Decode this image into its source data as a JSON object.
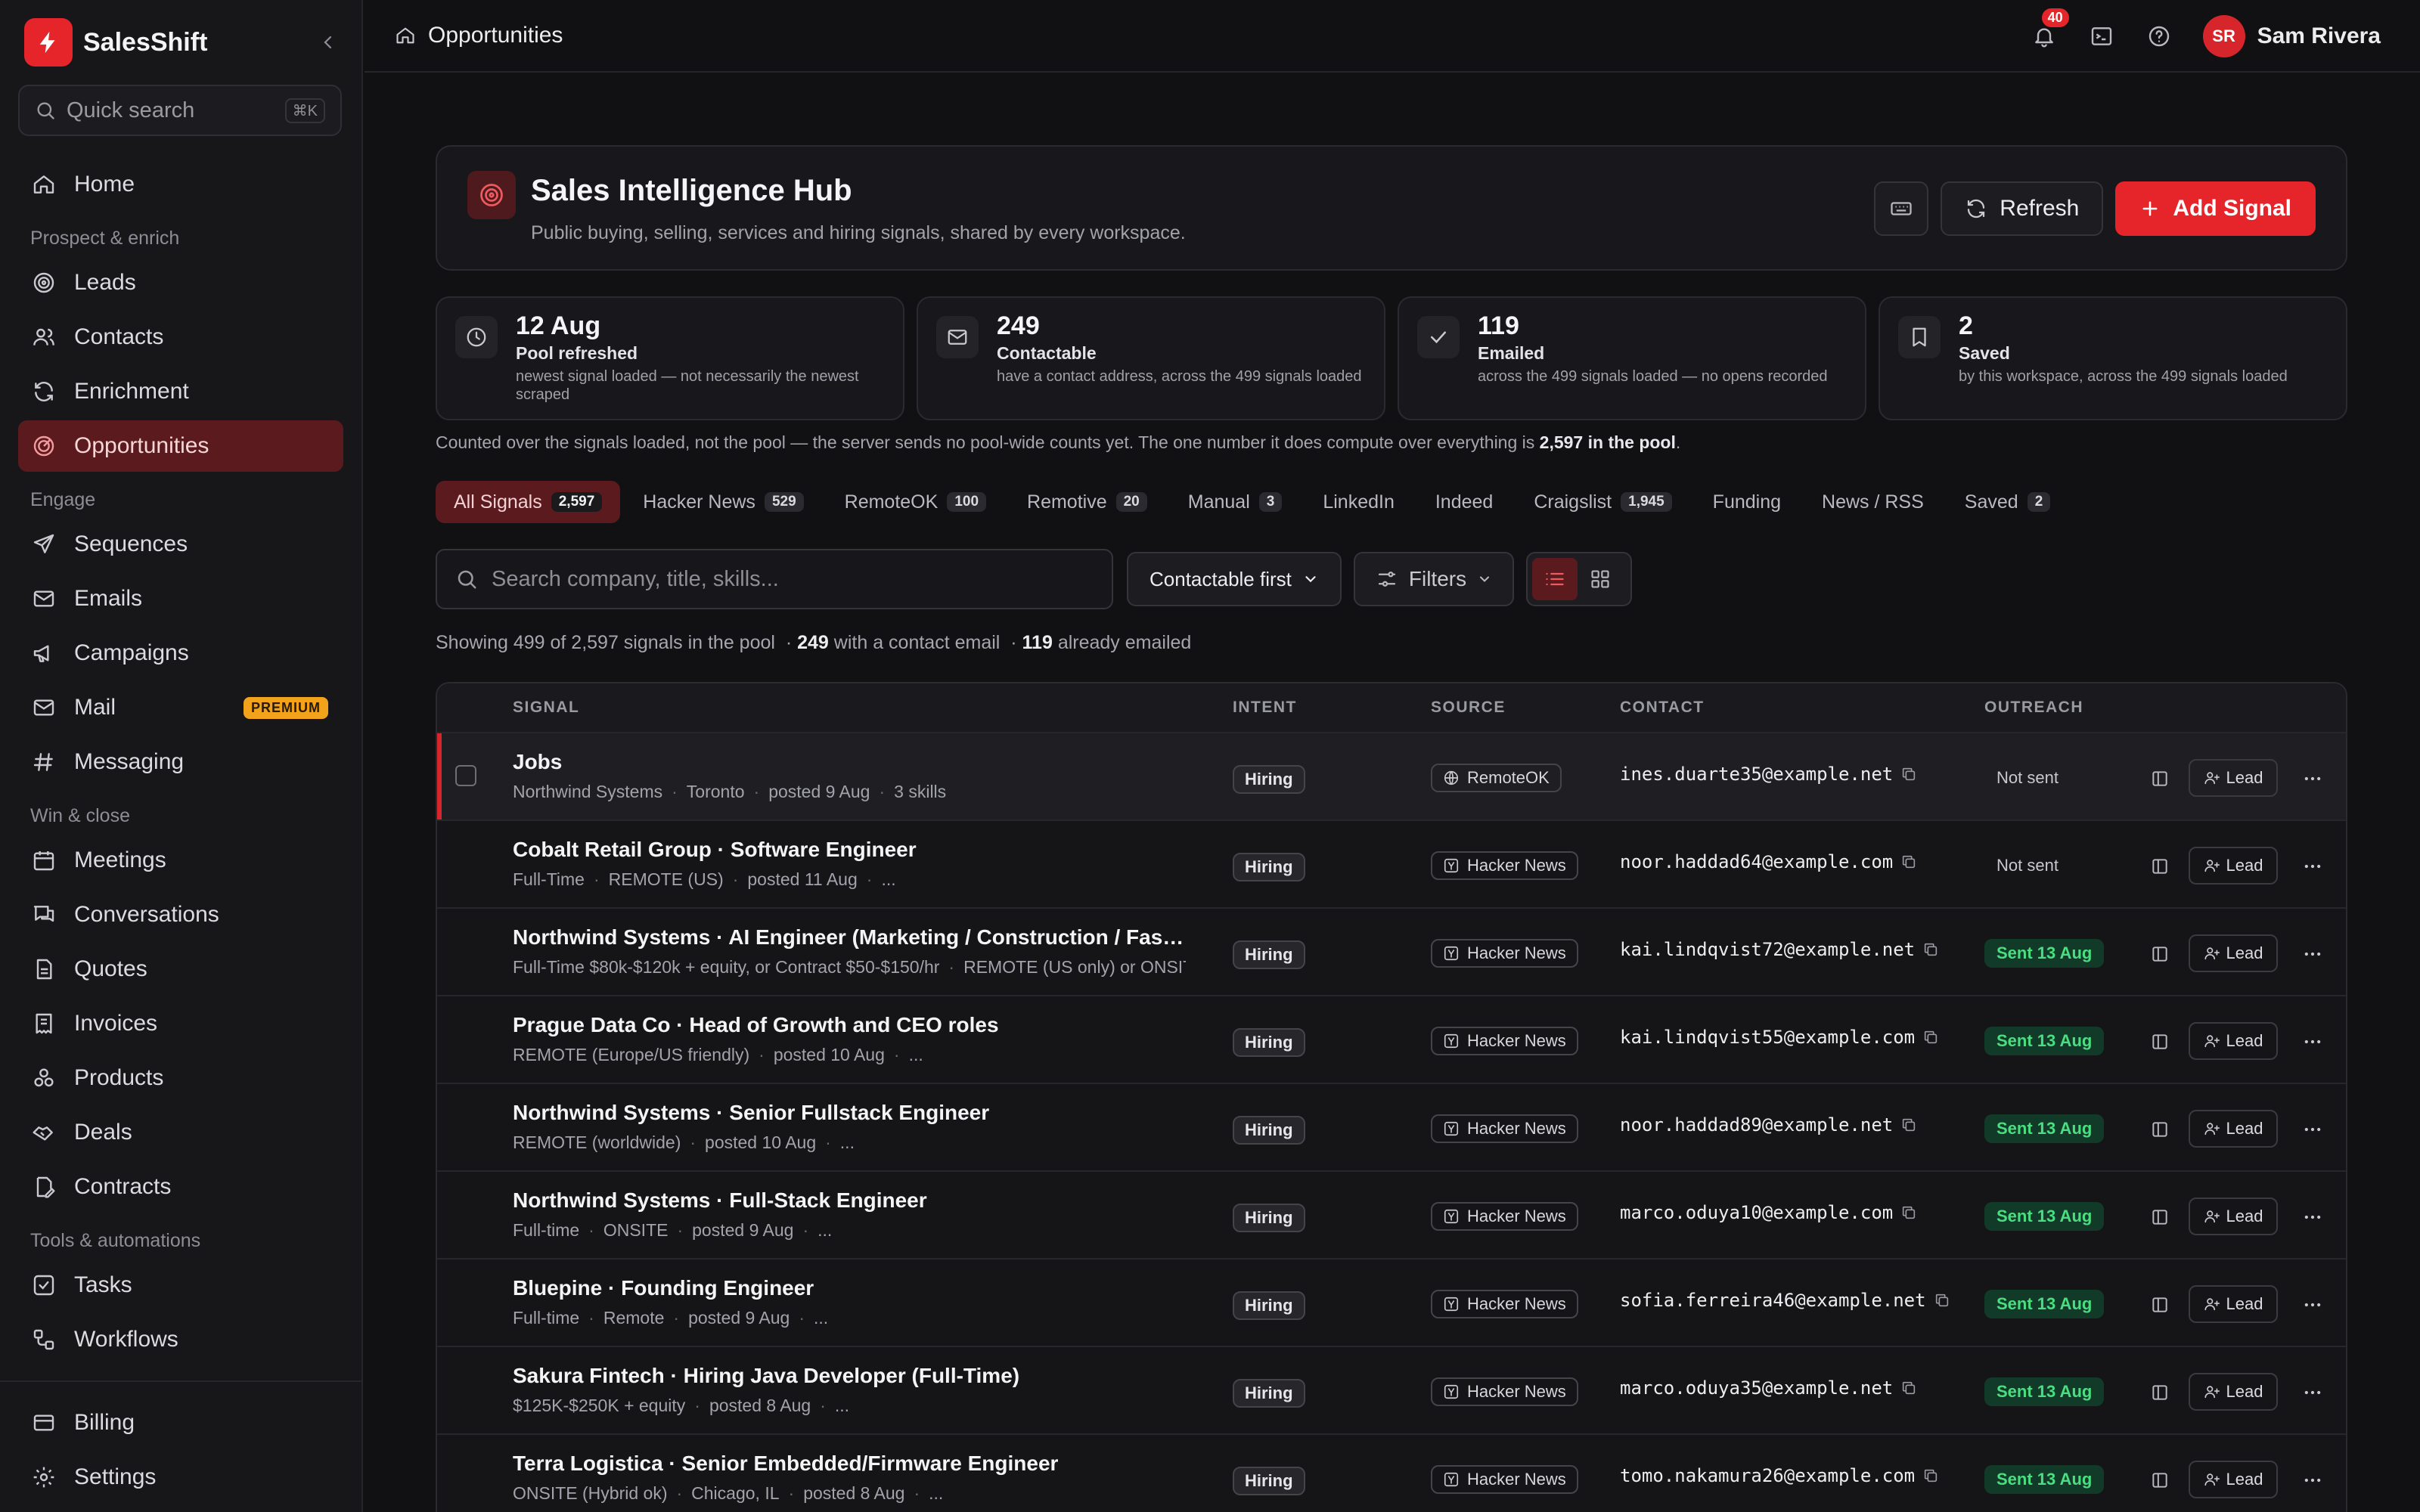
{
  "brand": {
    "name": "SalesShift"
  },
  "colors": {
    "accent": "#E5252A",
    "active_bg": "#5B1A1E",
    "sent_green": "#4ADE80",
    "premium": "#F2A21B"
  },
  "sidebar": {
    "quick_search": {
      "label": "Quick search",
      "shortcut": "⌘K"
    },
    "home": {
      "label": "Home",
      "icon": "home-icon"
    },
    "sections": [
      {
        "title": "Prospect & enrich",
        "items": [
          {
            "label": "Leads",
            "icon": "target-icon"
          },
          {
            "label": "Contacts",
            "icon": "users-icon"
          },
          {
            "label": "Enrichment",
            "icon": "refresh-icon"
          },
          {
            "label": "Opportunities",
            "icon": "radar-icon",
            "active": true
          }
        ]
      },
      {
        "title": "Engage",
        "items": [
          {
            "label": "Sequences",
            "icon": "send-icon"
          },
          {
            "label": "Emails",
            "icon": "mail-icon"
          },
          {
            "label": "Campaigns",
            "icon": "megaphone-icon"
          },
          {
            "label": "Mail",
            "icon": "inbox-icon",
            "badge": "PREMIUM"
          },
          {
            "label": "Messaging",
            "icon": "hash-icon"
          }
        ]
      },
      {
        "title": "Win & close",
        "items": [
          {
            "label": "Meetings",
            "icon": "calendar-icon"
          },
          {
            "label": "Conversations",
            "icon": "chat-icon"
          },
          {
            "label": "Quotes",
            "icon": "document-icon"
          },
          {
            "label": "Invoices",
            "icon": "receipt-icon"
          },
          {
            "label": "Products",
            "icon": "boxes-icon"
          },
          {
            "label": "Deals",
            "icon": "handshake-icon"
          },
          {
            "label": "Contracts",
            "icon": "contract-icon"
          }
        ]
      },
      {
        "title": "Tools & automations",
        "items": [
          {
            "label": "Tasks",
            "icon": "checkbox-icon"
          },
          {
            "label": "Workflows",
            "icon": "workflow-icon"
          }
        ]
      }
    ],
    "footer": [
      {
        "label": "Billing",
        "icon": "card-icon"
      },
      {
        "label": "Settings",
        "icon": "gear-icon"
      }
    ]
  },
  "topbar": {
    "breadcrumb": "Opportunities",
    "notification_count": "40",
    "user": {
      "initials": "SR",
      "name": "Sam Rivera"
    }
  },
  "hub": {
    "title": "Sales Intelligence Hub",
    "subtitle": "Public buying, selling, services and hiring signals, shared by every workspace.",
    "refresh_label": "Refresh",
    "add_label": "Add Signal"
  },
  "stats": [
    {
      "value": "12 Aug",
      "label": "Pool refreshed",
      "desc": "newest signal loaded — not necessarily the newest scraped",
      "icon": "clock-icon"
    },
    {
      "value": "249",
      "label": "Contactable",
      "desc": "have a contact address, across the 499 signals loaded",
      "icon": "mail-icon"
    },
    {
      "value": "119",
      "label": "Emailed",
      "desc": "across the 499 signals loaded — no opens recorded",
      "icon": "check-icon"
    },
    {
      "value": "2",
      "label": "Saved",
      "desc": "by this workspace, across the 499 signals loaded",
      "icon": "bookmark-icon"
    }
  ],
  "counted_note": {
    "text": "Counted over the signals loaded, not the pool — the server sends no pool-wide counts yet. The one number it does compute over everything is ",
    "bold": "2,597 in the pool",
    "end": "."
  },
  "tabs": [
    {
      "label": "All Signals",
      "count": "2,597",
      "active": true
    },
    {
      "label": "Hacker News",
      "count": "529"
    },
    {
      "label": "RemoteOK",
      "count": "100"
    },
    {
      "label": "Remotive",
      "count": "20"
    },
    {
      "label": "Manual",
      "count": "3"
    },
    {
      "label": "LinkedIn",
      "count": ""
    },
    {
      "label": "Indeed",
      "count": ""
    },
    {
      "label": "Craigslist",
      "count": "1,945"
    },
    {
      "label": "Funding",
      "count": ""
    },
    {
      "label": "News / RSS",
      "count": ""
    },
    {
      "label": "Saved",
      "count": "2"
    }
  ],
  "toolbar": {
    "search_placeholder": "Search company, title, skills...",
    "sort_value": "Contactable first",
    "filters_label": "Filters"
  },
  "showing": {
    "prefix": "Showing 499 of 2,597 signals in the pool",
    "contactable": "249",
    "contactable_text": "with a contact email",
    "emailed": "119",
    "emailed_text": "already emailed"
  },
  "table": {
    "headers": {
      "signal": "SIGNAL",
      "intent": "INTENT",
      "source": "SOURCE",
      "contact": "CONTACT",
      "outreach": "OUTREACH"
    },
    "lead_label": "Lead",
    "rows": [
      {
        "title": "Jobs",
        "meta": [
          "Northwind Systems",
          "Toronto",
          "posted 9 Aug",
          "3 skills"
        ],
        "intent": "Hiring",
        "source": "RemoteOK",
        "source_icon": "globe-icon",
        "contact": "ines.duarte35@example.net",
        "outreach": "Not sent",
        "sent": false,
        "highlight": true
      },
      {
        "title": "Cobalt Retail Group · Software Engineer",
        "meta": [
          "Full-Time",
          "REMOTE (US)",
          "posted 11 Aug",
          "..."
        ],
        "intent": "Hiring",
        "source": "Hacker News",
        "source_icon": "hn-icon",
        "contact": "noor.haddad64@example.com",
        "outreach": "Not sent",
        "sent": false
      },
      {
        "title": "Northwind Systems · AI Engineer (Marketing / Construction / Fashion ...",
        "meta": [
          "Full-Time $80k-$120k + equity, or Contract $50-$150/hr",
          "REMOTE (US only) or ONSITE"
        ],
        "intent": "Hiring",
        "source": "Hacker News",
        "source_icon": "hn-icon",
        "contact": "kai.lindqvist72@example.net",
        "outreach": "Sent 13 Aug",
        "sent": true
      },
      {
        "title": "Prague Data Co · Head of Growth and CEO roles",
        "meta": [
          "REMOTE (Europe/US friendly)",
          "posted 10 Aug",
          "..."
        ],
        "intent": "Hiring",
        "source": "Hacker News",
        "source_icon": "hn-icon",
        "contact": "kai.lindqvist55@example.com",
        "outreach": "Sent 13 Aug",
        "sent": true
      },
      {
        "title": "Northwind Systems · Senior Fullstack Engineer",
        "meta": [
          "REMOTE (worldwide)",
          "posted 10 Aug",
          "..."
        ],
        "intent": "Hiring",
        "source": "Hacker News",
        "source_icon": "hn-icon",
        "contact": "noor.haddad89@example.net",
        "outreach": "Sent 13 Aug",
        "sent": true
      },
      {
        "title": "Northwind Systems · Full-Stack Engineer",
        "meta": [
          "Full-time",
          "ONSITE",
          "posted 9 Aug",
          "..."
        ],
        "intent": "Hiring",
        "source": "Hacker News",
        "source_icon": "hn-icon",
        "contact": "marco.oduya10@example.com",
        "outreach": "Sent 13 Aug",
        "sent": true
      },
      {
        "title": "Bluepine · Founding Engineer",
        "meta": [
          "Full-time",
          "Remote",
          "posted 9 Aug",
          "..."
        ],
        "intent": "Hiring",
        "source": "Hacker News",
        "source_icon": "hn-icon",
        "contact": "sofia.ferreira46@example.net",
        "outreach": "Sent 13 Aug",
        "sent": true
      },
      {
        "title": "Sakura Fintech · Hiring Java Developer (Full-Time)",
        "meta": [
          "$125K-$250K + equity",
          "posted 8 Aug",
          "..."
        ],
        "intent": "Hiring",
        "source": "Hacker News",
        "source_icon": "hn-icon",
        "contact": "marco.oduya35@example.net",
        "outreach": "Sent 13 Aug",
        "sent": true
      },
      {
        "title": "Terra Logistica · Senior Embedded/Firmware Engineer",
        "meta": [
          "ONSITE (Hybrid ok)",
          "Chicago, IL",
          "posted 8 Aug",
          "..."
        ],
        "intent": "Hiring",
        "source": "Hacker News",
        "source_icon": "hn-icon",
        "contact": "tomo.nakamura26@example.com",
        "outreach": "Sent 13 Aug",
        "sent": true
      }
    ]
  }
}
